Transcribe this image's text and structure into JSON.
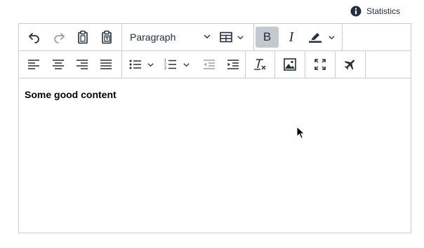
{
  "statistics": {
    "label": "Statistics",
    "icon": "info-circle-icon"
  },
  "toolbar": {
    "row1": {
      "undo": {
        "icon": "undo-icon"
      },
      "redo": {
        "icon": "redo-icon"
      },
      "paste": {
        "icon": "paste-icon"
      },
      "paste_text": {
        "icon": "paste-as-text-icon"
      },
      "format_select": {
        "value": "Paragraph"
      },
      "table": {
        "icon": "table-icon"
      },
      "bold": {
        "label": "B"
      },
      "italic": {
        "label": "I"
      },
      "highlight": {
        "icon": "highlight-color-icon",
        "color": "#222f3e"
      }
    },
    "row2": {
      "align_left": {
        "icon": "align-left-icon"
      },
      "align_center": {
        "icon": "align-center-icon"
      },
      "align_right": {
        "icon": "align-right-icon"
      },
      "align_justify": {
        "icon": "align-justify-icon"
      },
      "bullet_list": {
        "icon": "bullet-list-icon"
      },
      "numbered_list": {
        "icon": "numbered-list-icon"
      },
      "outdent": {
        "icon": "outdent-icon"
      },
      "indent": {
        "icon": "indent-icon"
      },
      "clear_formatting": {
        "icon": "clear-formatting-icon"
      },
      "image": {
        "icon": "image-icon"
      },
      "fullscreen": {
        "icon": "fullscreen-icon"
      },
      "custom": {
        "icon": "airplane-icon"
      }
    }
  },
  "content": {
    "text": "Some good content"
  },
  "colors": {
    "border": "#cccccc",
    "active_bg": "#c4c9cf",
    "icon": "#222f3e"
  }
}
